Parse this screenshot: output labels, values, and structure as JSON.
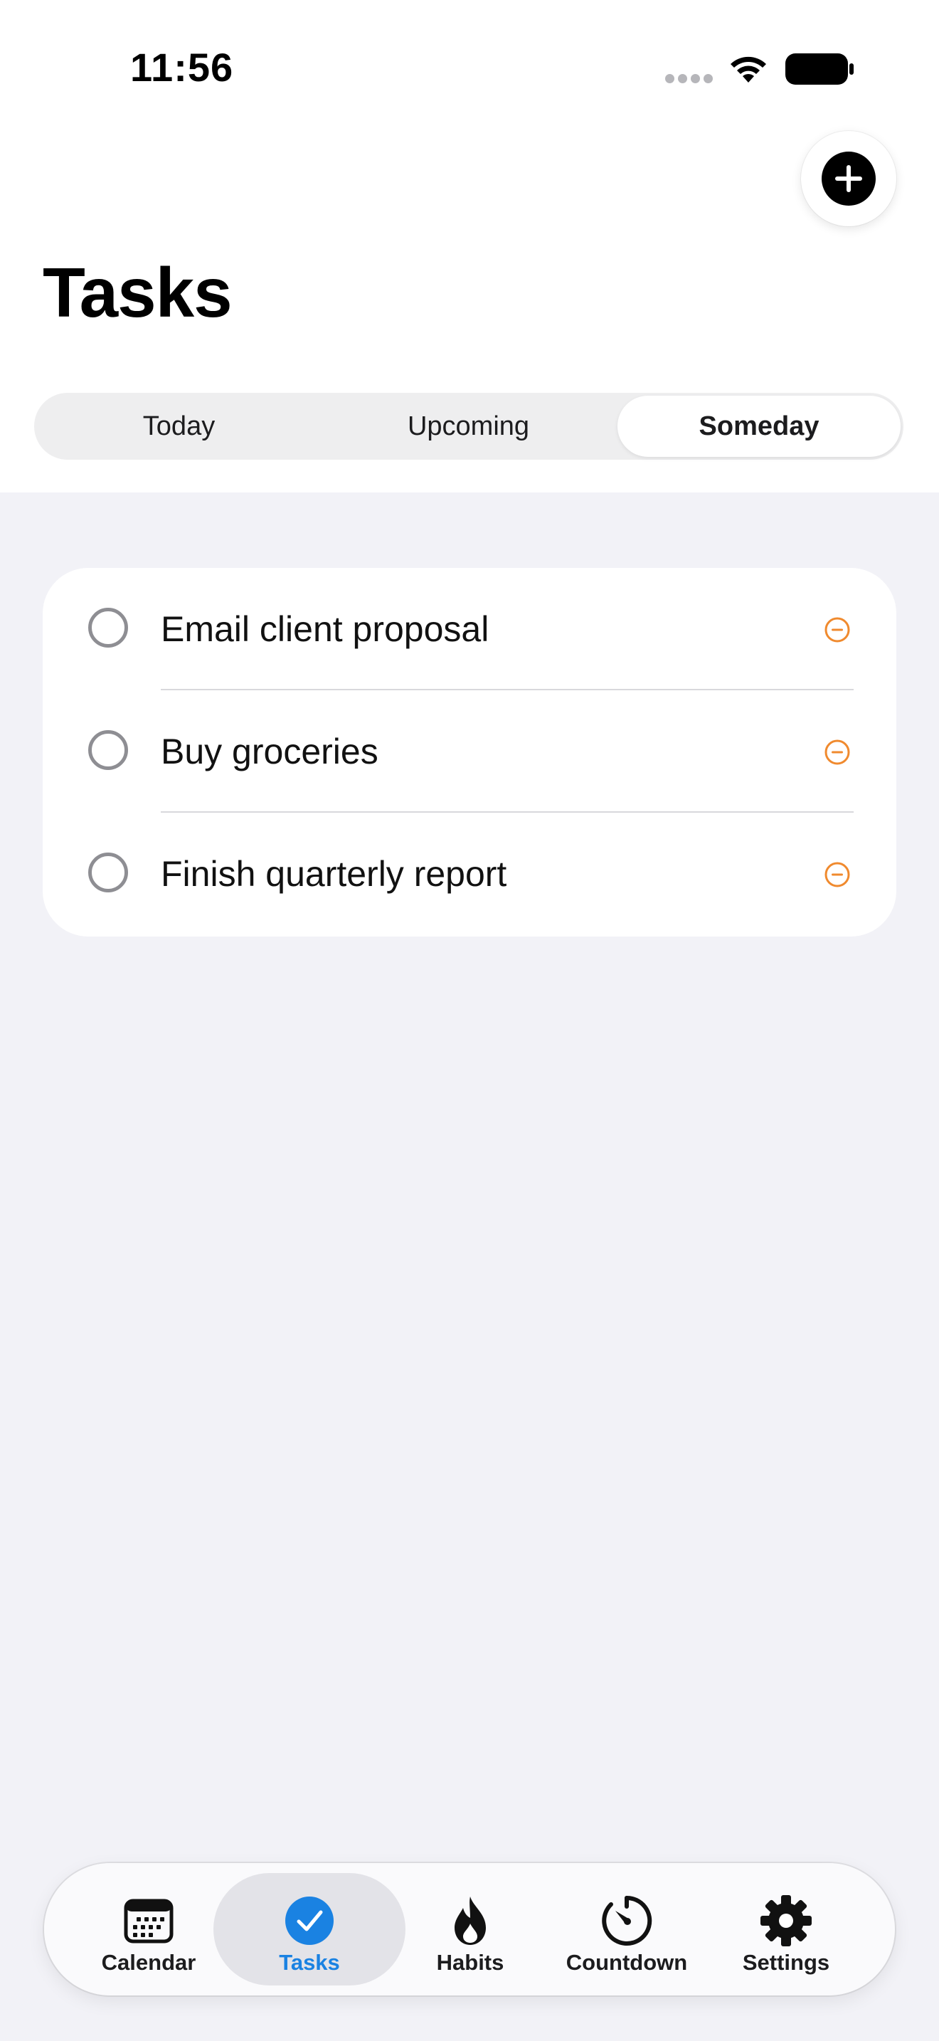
{
  "status_bar": {
    "time": "11:56"
  },
  "header": {
    "title": "Tasks"
  },
  "segments": [
    {
      "label": "Today",
      "selected": false
    },
    {
      "label": "Upcoming",
      "selected": false
    },
    {
      "label": "Someday",
      "selected": true
    }
  ],
  "tasks": [
    {
      "title": "Email client proposal",
      "icon": "priority-minus-icon"
    },
    {
      "title": "Buy groceries",
      "icon": "priority-minus-icon"
    },
    {
      "title": "Finish quarterly report",
      "icon": "priority-minus-icon"
    }
  ],
  "tabbar": {
    "items": [
      {
        "label": "Calendar",
        "icon": "calendar-icon",
        "active": false
      },
      {
        "label": "Tasks",
        "icon": "checkmark-circle-icon",
        "active": true
      },
      {
        "label": "Habits",
        "icon": "flame-icon",
        "active": false
      },
      {
        "label": "Countdown",
        "icon": "timer-icon",
        "active": false
      },
      {
        "label": "Settings",
        "icon": "gear-icon",
        "active": false
      }
    ]
  },
  "colors": {
    "accent": "#1A82E2",
    "priority": "#F08A2E",
    "background": "#F2F2F7"
  }
}
